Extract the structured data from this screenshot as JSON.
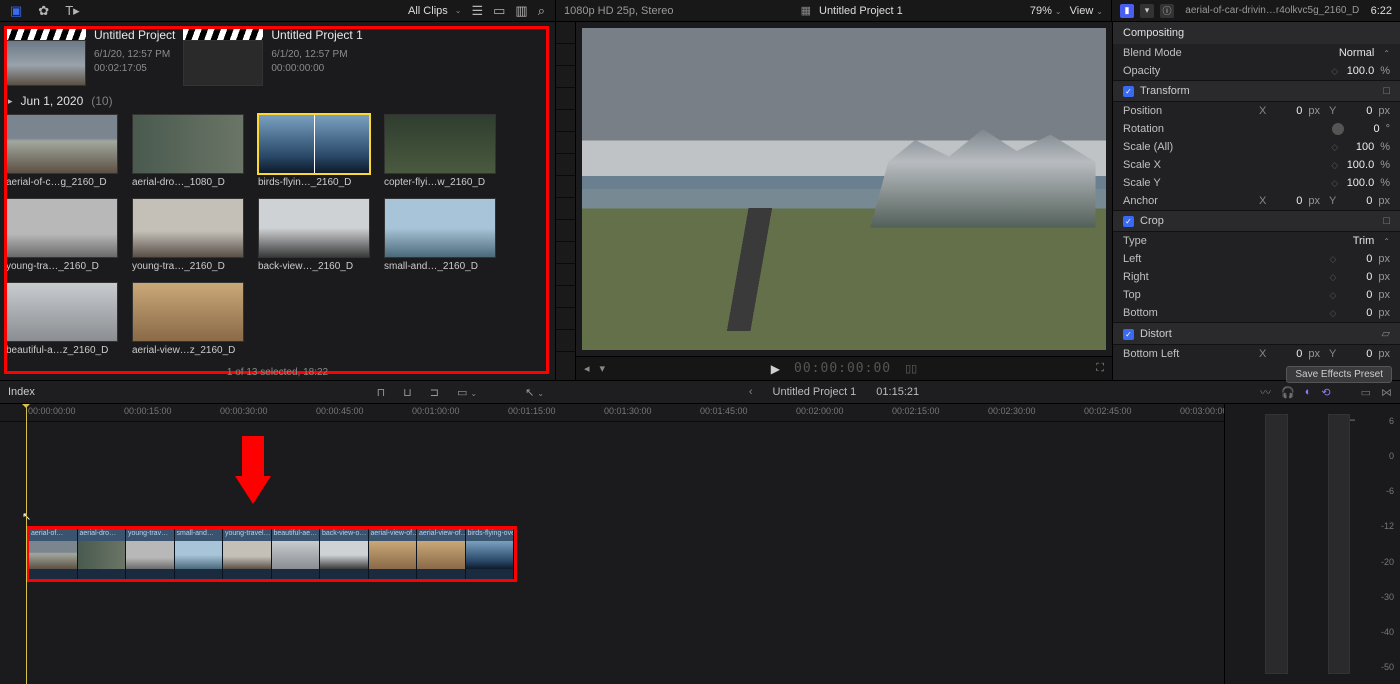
{
  "appbar": {
    "filter_label": "All Clips",
    "format_info": "1080p HD 25p, Stereo",
    "project_title": "Untitled Project 1",
    "zoom": "79%",
    "view_label": "View",
    "inspector_clip": "aerial-of-car-drivin…r4olkvc5g_2160_D",
    "inspector_tc": "6:22"
  },
  "browser": {
    "projects": [
      {
        "name": "Untitled Project",
        "date": "6/1/20, 12:57 PM",
        "duration": "00:02:17:05",
        "empty": false
      },
      {
        "name": "Untitled Project 1",
        "date": "6/1/20, 12:57 PM",
        "duration": "00:00:00:00",
        "empty": true
      }
    ],
    "group_date": "Jun 1, 2020",
    "group_count": "(10)",
    "clips": [
      {
        "label": "aerial-of-c…g_2160_D",
        "thumb": "th-road"
      },
      {
        "label": "aerial-dro…_1080_D",
        "thumb": "th-falls"
      },
      {
        "label": "birds-flyin…_2160_D",
        "thumb": "th-ice",
        "selected": true
      },
      {
        "label": "copter-flyi…w_2160_D",
        "thumb": "th-valley"
      },
      {
        "label": "young-tra…_2160_D",
        "thumb": "th-trav1"
      },
      {
        "label": "young-tra…_2160_D",
        "thumb": "th-trav2"
      },
      {
        "label": "back-view…_2160_D",
        "thumb": "th-back"
      },
      {
        "label": "small-and…_2160_D",
        "thumb": "th-small"
      },
      {
        "label": "beautiful-a…z_2160_D",
        "thumb": "th-glacier"
      },
      {
        "label": "aerial-view…z_2160_D",
        "thumb": "th-aerialv"
      }
    ],
    "status": "1 of 13 selected, 18:22"
  },
  "viewer": {
    "timecode": "00:00:00:00"
  },
  "inspector": {
    "compositing": "Compositing",
    "blend_mode_label": "Blend Mode",
    "blend_mode_value": "Normal",
    "opacity_label": "Opacity",
    "opacity_value": "100.0",
    "opacity_unit": "%",
    "transform": "Transform",
    "position_label": "Position",
    "pos_x": "0",
    "pos_y": "0",
    "px": "px",
    "rotation_label": "Rotation",
    "rotation_value": "0",
    "deg": "°",
    "scale_all_label": "Scale (All)",
    "scale_all": "100",
    "pct": "%",
    "scale_x_label": "Scale X",
    "scale_x": "100.0",
    "scale_y_label": "Scale Y",
    "scale_y": "100.0",
    "anchor_label": "Anchor",
    "anc_x": "0",
    "anc_y": "0",
    "crop": "Crop",
    "type_label": "Type",
    "type_value": "Trim",
    "left_label": "Left",
    "left_v": "0",
    "right_label": "Right",
    "right_v": "0",
    "top_label": "Top",
    "top_v": "0",
    "bottom_label": "Bottom",
    "bottom_v": "0",
    "distort": "Distort",
    "bl_label": "Bottom Left",
    "bl_x": "0",
    "bl_y": "0",
    "save_preset": "Save Effects Preset"
  },
  "toolbar": {
    "index": "Index",
    "timeline_title": "Untitled Project 1",
    "timeline_dur": "01:15:21"
  },
  "ruler_ticks": [
    "00:00:00:00",
    "00:00:15:00",
    "00:00:30:00",
    "00:00:45:00",
    "00:01:00:00",
    "00:01:15:00",
    "00:01:30:00",
    "00:01:45:00",
    "00:02:00:00",
    "00:02:15:00",
    "00:02:30:00",
    "00:02:45:00",
    "00:03:00:00"
  ],
  "timeline_clips": [
    "aerial-of…",
    "aerial-dro…",
    "young-trav…",
    "small-and…",
    "young-travel…",
    "beautiful-ae…",
    "back-view-o…",
    "aerial-view-of…",
    "aerial-view-of…",
    "birds-flying-ove…"
  ],
  "meter_scale": [
    "6",
    "0",
    "-6",
    "-12",
    "-20",
    "-30",
    "-40",
    "-50"
  ]
}
